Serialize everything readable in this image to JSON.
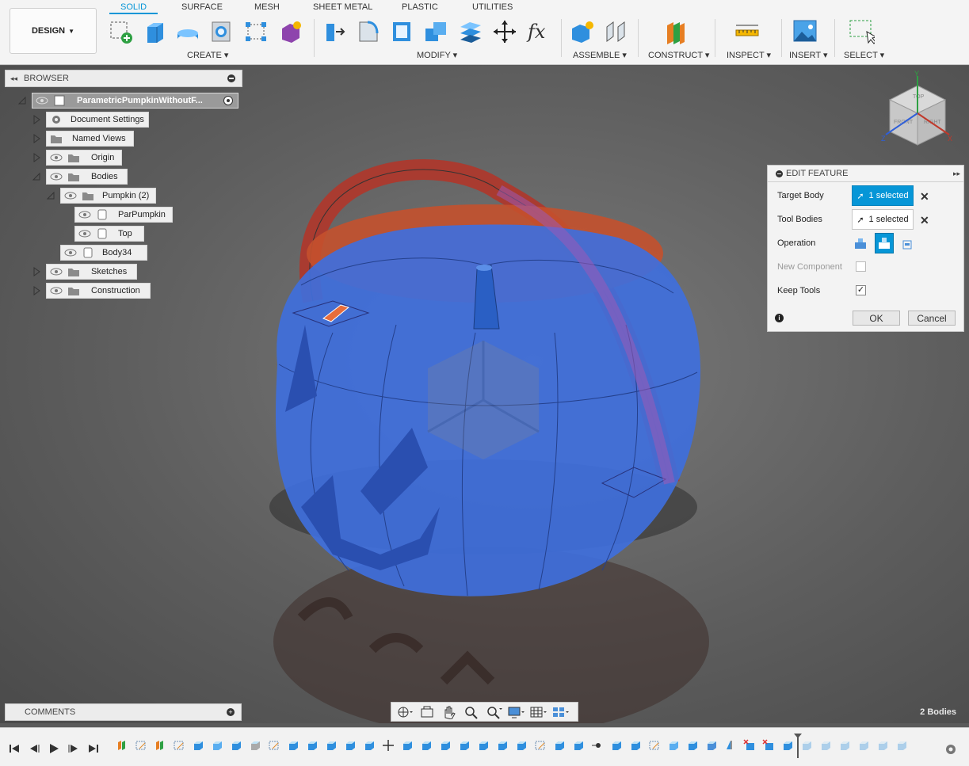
{
  "workspace": {
    "label": "DESIGN"
  },
  "tabs": [
    {
      "label": "SOLID"
    },
    {
      "label": "SURFACE"
    },
    {
      "label": "MESH"
    },
    {
      "label": "SHEET METAL"
    },
    {
      "label": "PLASTIC"
    },
    {
      "label": "UTILITIES"
    }
  ],
  "groups": {
    "create": "CREATE",
    "modify": "MODIFY",
    "assemble": "ASSEMBLE",
    "construct": "CONSTRUCT",
    "inspect": "INSPECT",
    "insert": "INSERT",
    "select": "SELECT"
  },
  "browser": {
    "title": "BROWSER",
    "root": "ParametricPumpkinWithoutF...",
    "items": {
      "document_settings": "Document Settings",
      "named_views": "Named Views",
      "origin": "Origin",
      "bodies": "Bodies",
      "pumpkin": "Pumpkin (2)",
      "parpumpkin": "ParPumpkin",
      "top": "Top",
      "body34": "Body34",
      "sketches": "Sketches",
      "construction": "Construction"
    }
  },
  "view_cube": {
    "top": "TOP",
    "front": "FRONT",
    "right": "RIGHT",
    "x": "X",
    "y": "Y",
    "z": "Z"
  },
  "edit_feature": {
    "title": "EDIT FEATURE",
    "target_body_label": "Target Body",
    "target_body_value": "1 selected",
    "tool_bodies_label": "Tool Bodies",
    "tool_bodies_value": "1 selected",
    "operation_label": "Operation",
    "new_component_label": "New Component",
    "keep_tools_label": "Keep Tools",
    "keep_tools_checked": "✓",
    "ok_label": "OK",
    "cancel_label": "Cancel"
  },
  "comments": {
    "title": "COMMENTS"
  },
  "status": {
    "bodies": "2 Bodies"
  },
  "colors": {
    "accent": "#0696d7",
    "pumpkin_blue": "#3a6fd8",
    "handle_red": "#c0392b"
  }
}
